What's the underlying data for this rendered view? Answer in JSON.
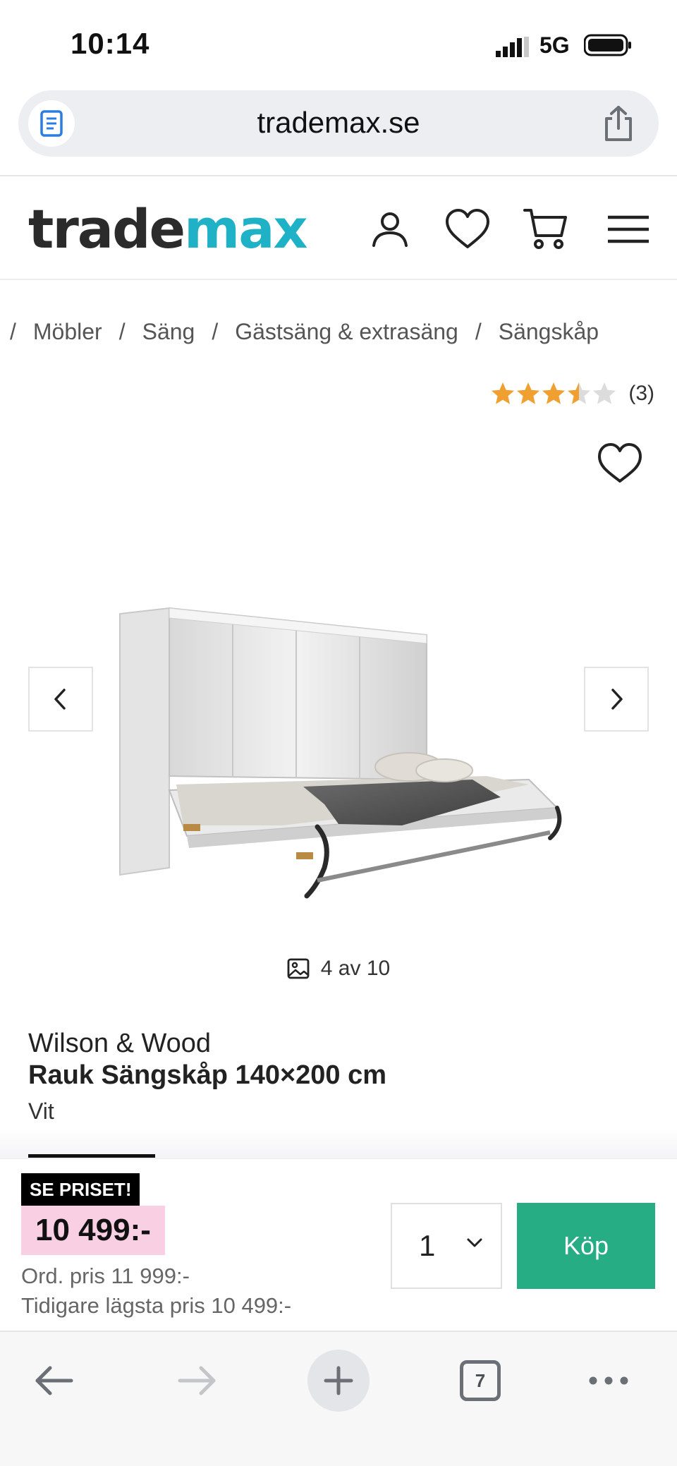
{
  "status_bar": {
    "time": "10:14",
    "network": "5G"
  },
  "browser": {
    "url": "trademax.se",
    "open_tabs": "7"
  },
  "header": {
    "logo_part1": "trade",
    "logo_part2": "max"
  },
  "breadcrumb": {
    "items": [
      "Möbler",
      "Säng",
      "Gästsäng & extrasäng",
      "Sängskåp"
    ],
    "separator": "/"
  },
  "rating": {
    "value": 3.5,
    "max": 5,
    "count": "(3)"
  },
  "gallery": {
    "counter": "4 av 10"
  },
  "product": {
    "brand": "Wilson & Wood",
    "name": "Rauk Sängskåp 140×200 cm",
    "variant": "Vit"
  },
  "pricing": {
    "tag": "SE PRISET!",
    "price": "10 499:-",
    "ordinary": "Ord. pris 11 999:-",
    "lowest": "Tidigare lägsta pris 10 499:-"
  },
  "buy": {
    "quantity": "1",
    "button_label": "Köp"
  },
  "colors": {
    "brand_dark": "#2b2b2b",
    "brand_accent": "#1fb2c6",
    "buy_button": "#26ad84",
    "price_highlight": "#f9cfe3",
    "star": "#f0a030"
  }
}
